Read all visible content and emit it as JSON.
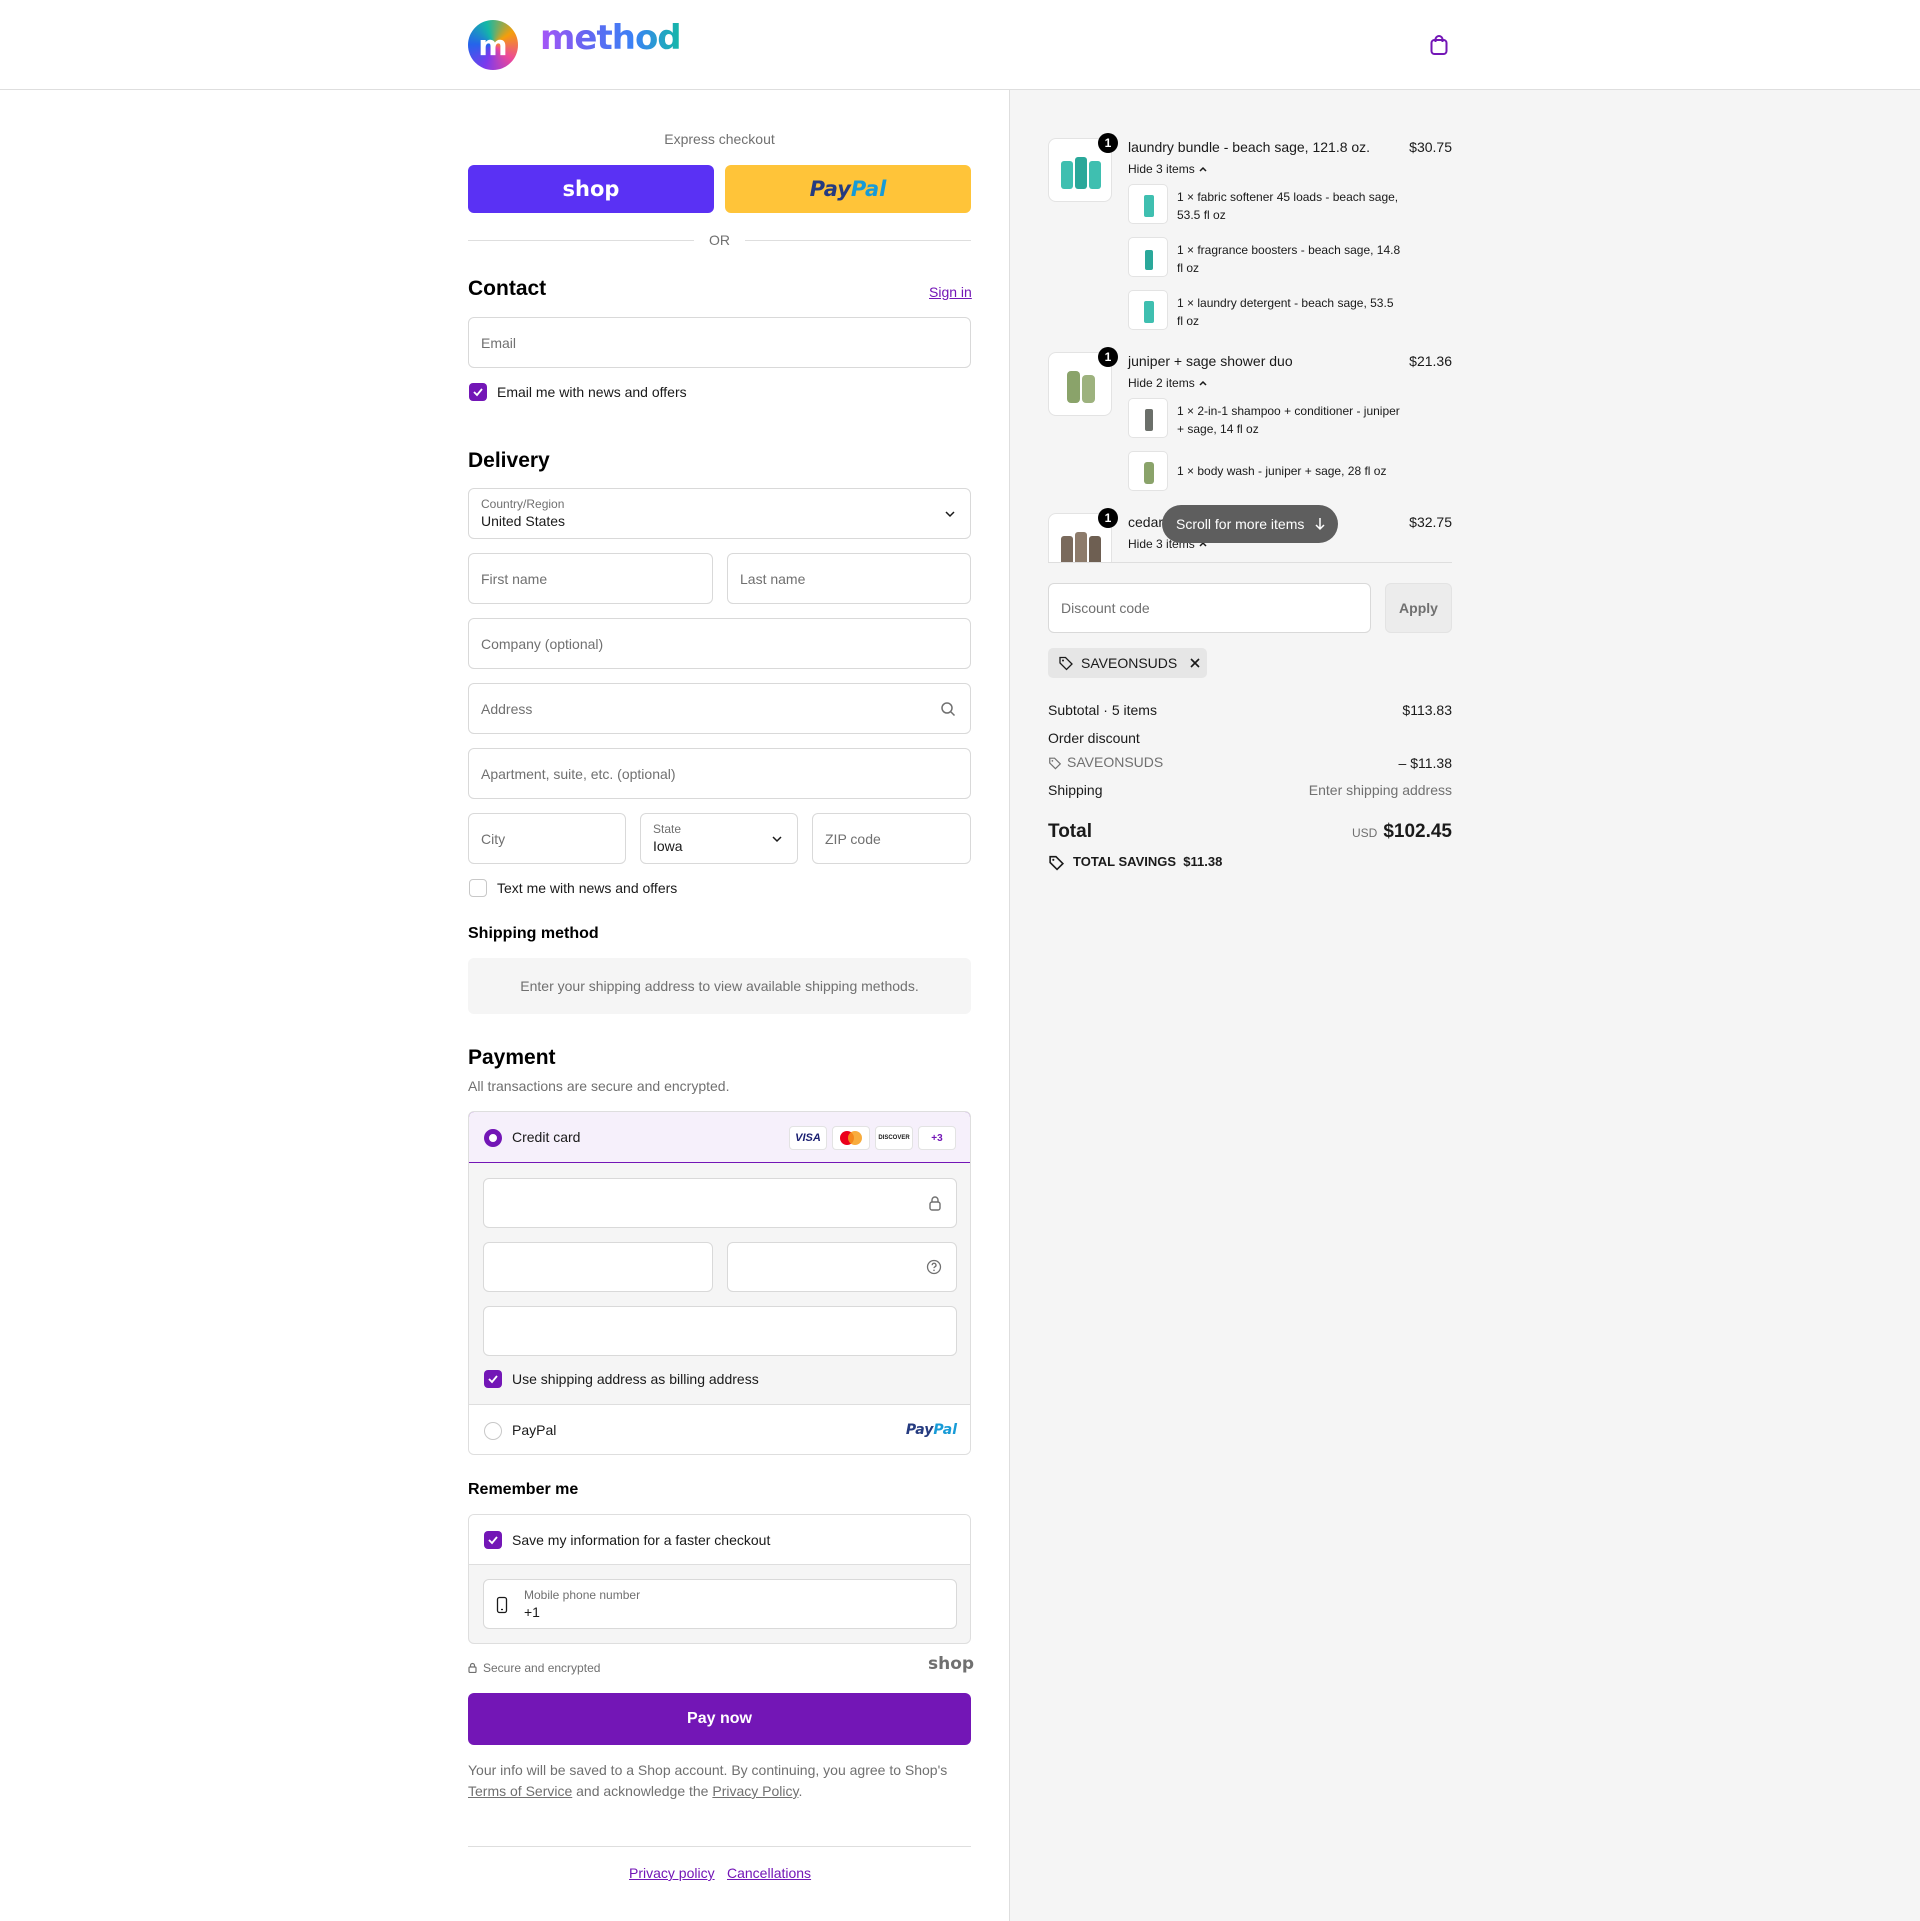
{
  "brand": {
    "name": "method",
    "logo_letter": "m"
  },
  "header": {
    "cart_icon": "bag-icon"
  },
  "colors": {
    "accent": "#7316b6",
    "shop": "#5a31f4",
    "paypal": "#ffc439",
    "pay_button": "#7316b6"
  },
  "express": {
    "title": "Express checkout",
    "shop_label": "shop",
    "paypal_label_1": "Pay",
    "paypal_label_2": "Pal",
    "or": "OR"
  },
  "contact": {
    "title": "Contact",
    "sign_in": "Sign in",
    "email_placeholder": "Email",
    "news_label": "Email me with news and offers",
    "news_checked": true
  },
  "delivery": {
    "title": "Delivery",
    "country_label": "Country/Region",
    "country_value": "United States",
    "first_name": "First name",
    "last_name": "Last name",
    "company": "Company (optional)",
    "address": "Address",
    "apartment": "Apartment, suite, etc. (optional)",
    "city": "City",
    "state_label": "State",
    "state_value": "Iowa",
    "zip": "ZIP code",
    "text_label": "Text me with news and offers",
    "text_checked": false
  },
  "shipping_method": {
    "title": "Shipping method",
    "message": "Enter your shipping address to view available shipping methods."
  },
  "payment": {
    "title": "Payment",
    "subtitle": "All transactions are secure and encrypted.",
    "credit_card_label": "Credit card",
    "card_brands": [
      "VISA",
      "MC",
      "DISCOVER",
      "+3"
    ],
    "billing_label": "Use shipping address as billing address",
    "billing_checked": true,
    "paypal_label": "PayPal",
    "paypal_logo_1": "Pay",
    "paypal_logo_2": "Pal"
  },
  "remember": {
    "title": "Remember me",
    "save_label": "Save my information for a faster checkout",
    "save_checked": true,
    "phone_label": "Mobile phone number",
    "phone_value": "+1",
    "secure": "Secure and encrypted",
    "shop_logo": "shop"
  },
  "pay_now": "Pay now",
  "legal": {
    "text1": "Your info will be saved to a Shop account. By continuing, you agree to Shop's",
    "tos": "Terms of Service",
    "text2": "and acknowledge the",
    "privacy": "Privacy Policy",
    "end": "."
  },
  "footer": {
    "privacy": "Privacy policy",
    "cancellations": "Cancellations"
  },
  "order": {
    "items": [
      {
        "qty": "1",
        "name": "laundry bundle - beach sage, 121.8 oz.",
        "price": "$30.75",
        "toggle": "Hide 3 items",
        "subitems": [
          {
            "line1": "1 × fabric softener 45 loads - beach sage,",
            "line2": "53.5 fl oz"
          },
          {
            "line1": "1 × fragrance boosters - beach sage, 14.8",
            "line2": "fl oz"
          },
          {
            "line1": "1 × laundry detergent - beach sage, 53.5",
            "line2": "fl oz"
          }
        ]
      },
      {
        "qty": "1",
        "name": "juniper + sage shower duo",
        "price": "$21.36",
        "toggle": "Hide 2 items",
        "subitems": [
          {
            "line1": "1 × 2-in-1 shampoo + conditioner - juniper",
            "line2": "+ sage, 14 fl oz"
          },
          {
            "line1": "1 × body wash - juniper + sage, 28 fl oz",
            "line2": ""
          }
        ]
      },
      {
        "qty": "1",
        "name": "cedar",
        "price": "$32.75",
        "toggle": "Hide 3 items",
        "subitems": []
      }
    ],
    "scroll_hint": "Scroll for more items",
    "discount_placeholder": "Discount code",
    "apply": "Apply",
    "applied_code": "SAVEONSUDS",
    "subtotal_label": "Subtotal · 5 items",
    "subtotal": "$113.83",
    "order_discount_label": "Order discount",
    "discount_code": "SAVEONSUDS",
    "discount_value": "– $11.38",
    "shipping_label": "Shipping",
    "shipping_value": "Enter shipping address",
    "total_label": "Total",
    "currency": "USD",
    "total": "$102.45",
    "savings_label": "TOTAL SAVINGS",
    "savings_value": "$11.38"
  }
}
